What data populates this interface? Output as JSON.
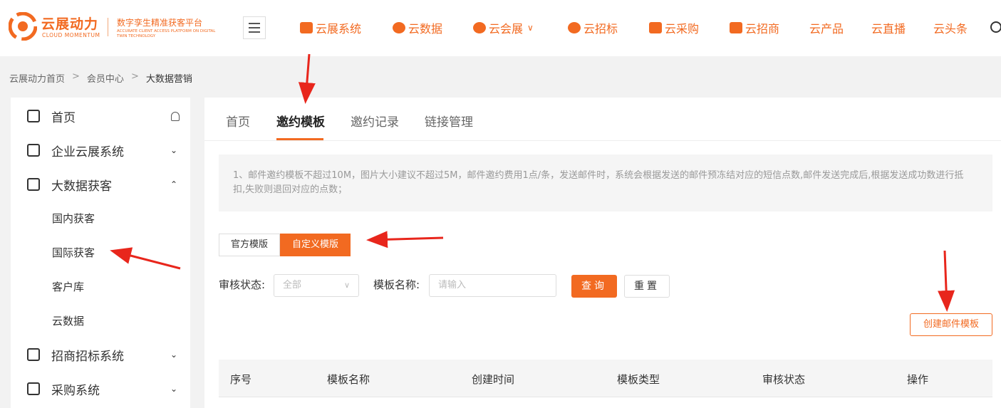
{
  "brand": {
    "name_cn": "云展动力",
    "name_en": "CLOUD MOMENTUM",
    "slogan": "数字孪生精准获客平台",
    "slogan_en": "ACCURATE CLIENT ACCESS PLATFORM ON DIGITAL TWIN TECHNOLOGY"
  },
  "nav": [
    {
      "label": "云展系统",
      "icon": "chart-icon"
    },
    {
      "label": "云数据",
      "icon": "cloud-icon"
    },
    {
      "label": "云会展",
      "icon": "user-icon"
    },
    {
      "label": "云招标",
      "icon": "target-icon"
    },
    {
      "label": "云采购",
      "icon": "bag-icon"
    },
    {
      "label": "云招商",
      "icon": "store-icon"
    },
    {
      "label": "云产品"
    },
    {
      "label": "云直播"
    },
    {
      "label": "云头条"
    }
  ],
  "breadcrumb": {
    "items": [
      "云展动力首页",
      "会员中心",
      "大数据营销"
    ],
    "sep": ">"
  },
  "sidebar": {
    "items": [
      {
        "label": "首页",
        "icon": "home-icon"
      },
      {
        "label": "企业云展系统",
        "icon": "building-icon"
      },
      {
        "label": "大数据获客",
        "icon": "network-icon"
      },
      {
        "label": "招商招标系统",
        "icon": "handshake-icon"
      },
      {
        "label": "采购系统",
        "icon": "bank-icon"
      }
    ],
    "sub": [
      "国内获客",
      "国际获客",
      "客户库",
      "云数据"
    ]
  },
  "tabs": [
    "首页",
    "邀约模板",
    "邀约记录",
    "链接管理"
  ],
  "active_tab": "邀约模板",
  "notice": "1、邮件邀约模板不超过10M，图片大小建议不超过5M，邮件邀约费用1点/条，发送邮件时，系统会根据发送的邮件预冻结对应的短信点数,邮件发送完成后,根据发送成功数进行抵扣,失败则退回对应的点数；",
  "template_toggle": {
    "official": "官方模版",
    "custom": "自定义模版"
  },
  "filters": {
    "status_label": "审核状态:",
    "status_value": "全部",
    "name_label": "模板名称:",
    "name_placeholder": "请输入",
    "query": "查询",
    "reset": "重置"
  },
  "create_button": "创建邮件模板",
  "table": {
    "headers": [
      "序号",
      "模板名称",
      "创建时间",
      "模板类型",
      "审核状态",
      "操作"
    ]
  },
  "colors": {
    "accent": "#f26a21",
    "annotation": "#e8261c"
  }
}
